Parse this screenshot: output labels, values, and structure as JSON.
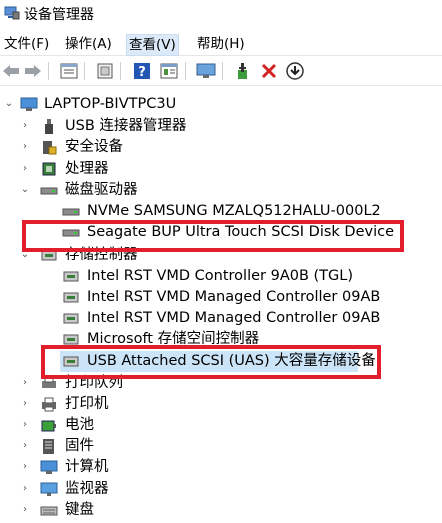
{
  "window": {
    "title": "设备管理器"
  },
  "menu": [
    "文件(F)",
    "操作(A)",
    "查看(V)",
    "帮助(H)"
  ],
  "toolbar": [
    "back-arrow-icon",
    "forward-arrow-icon",
    "properties-icon",
    "update-driver-icon",
    "help-icon",
    "view-icon",
    "monitor-scan-icon",
    "add-driver-icon",
    "remove-icon",
    "download-icon"
  ],
  "tree": {
    "root": "LAPTOP-BIVTPC3U",
    "items": [
      "USB 连接器管理器",
      "安全设备",
      "处理器",
      "磁盘驱动器",
      "NVMe SAMSUNG MZALQ512HALU-000L2",
      "Seagate BUP Ultra Touch SCSI Disk Device",
      "存储控制器",
      "Intel RST VMD Controller 9A0B (TGL)",
      "Intel RST VMD Managed Controller 09AB",
      "Intel RST VMD Managed Controller 09AB",
      "Microsoft 存储空间控制器",
      "USB Attached SCSI (UAS) 大容量存储设备",
      "打印队列",
      "打印机",
      "电池",
      "固件",
      "计算机",
      "监视器",
      "键盘"
    ]
  },
  "colors": {
    "highlight": "#e21e2c",
    "selection": "#cce4f7"
  }
}
